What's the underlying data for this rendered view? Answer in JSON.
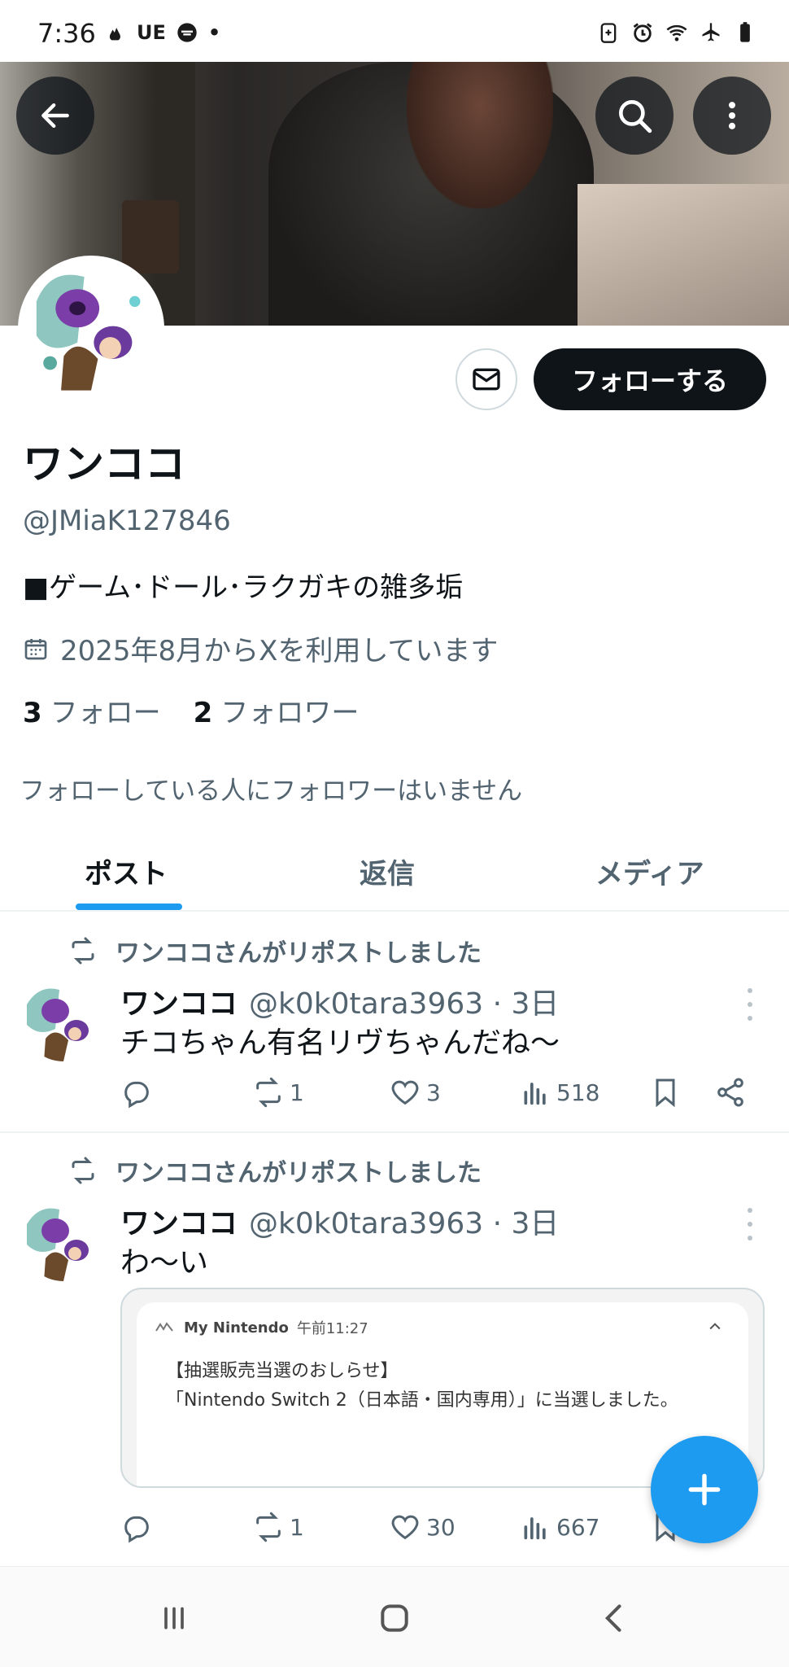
{
  "status_bar": {
    "time": "7:36",
    "ue_label": "UE",
    "dot": "•"
  },
  "header": {
    "back_icon": "arrow-left-icon",
    "search_icon": "search-icon",
    "more_icon": "more-vertical-icon"
  },
  "profile": {
    "name": "ワンココ",
    "handle": "@JMiaK127846",
    "bio": "■ゲーム･ドール･ラクガキの雑多垢",
    "joined": "2025年8月からXを利用しています",
    "following_count": "3",
    "following_label": "フォロー",
    "followers_count": "2",
    "followers_label": "フォロワー",
    "mutual_note": "フォローしている人にフォロワーはいません",
    "follow_button": "フォローする"
  },
  "tabs": [
    {
      "label": "ポスト",
      "active": true
    },
    {
      "label": "返信",
      "active": false
    },
    {
      "label": "メディア",
      "active": false
    }
  ],
  "posts": [
    {
      "repost_label": "ワンココさんがリポストしました",
      "name": "ワンココ",
      "handle_time": "@k0k0tara3963 · 3日",
      "text": "チコちゃん有名リヴちゃんだね〜",
      "replies": "",
      "reposts": "1",
      "likes": "3",
      "views": "518"
    },
    {
      "repost_label": "ワンココさんがリポストしました",
      "name": "ワンココ",
      "handle_time": "@k0k0tara3963 · 3日",
      "text": "わ〜い",
      "embed": {
        "app": "My Nintendo",
        "time": "午前11:27",
        "line1": "【抽選販売当選のおしらせ】",
        "line2": "「Nintendo Switch 2（日本語・国内専用）」に当選しました。"
      },
      "replies": "",
      "reposts": "1",
      "likes": "30",
      "views": "667"
    }
  ],
  "colors": {
    "accent": "#1d9bf0",
    "text": "#0f1419",
    "muted": "#536471",
    "border": "#cfd9de"
  }
}
